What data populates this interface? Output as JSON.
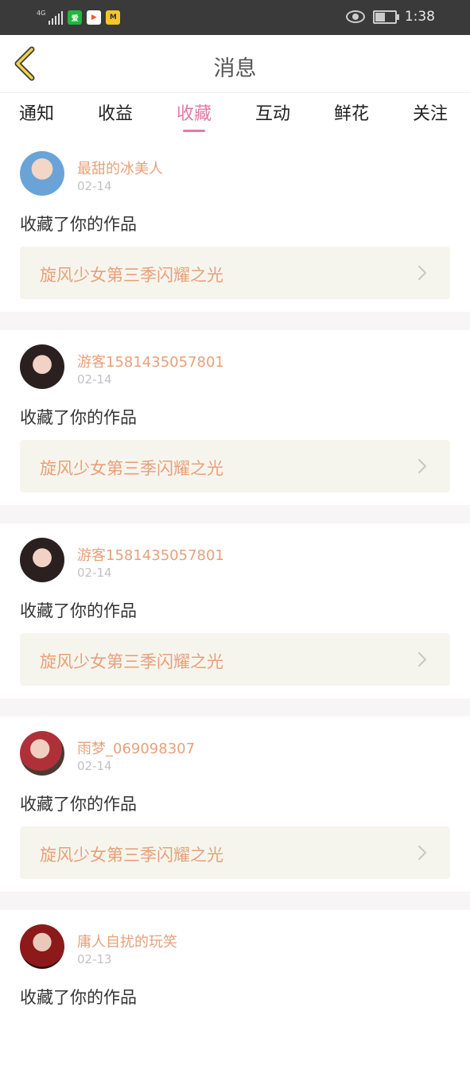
{
  "status_bar": {
    "network": "4G",
    "apps": [
      "爱奇艺",
      "哔哩",
      "M"
    ],
    "time": "1:38",
    "battery_level": 0.55
  },
  "header": {
    "title": "消息"
  },
  "tabs": [
    {
      "label": "通知",
      "active": false
    },
    {
      "label": "收益",
      "active": false
    },
    {
      "label": "收藏",
      "active": true
    },
    {
      "label": "互动",
      "active": false
    },
    {
      "label": "鲜花",
      "active": false
    },
    {
      "label": "关注",
      "active": false
    }
  ],
  "accent_color": "#e27aa6",
  "username_color": "#e8a07a",
  "messages": [
    {
      "user": "最甜的冰美人",
      "date": "02-14",
      "action": "收藏了你的作品",
      "work": "旋风少女第三季闪耀之光"
    },
    {
      "user": "游客1581435057801",
      "date": "02-14",
      "action": "收藏了你的作品",
      "work": "旋风少女第三季闪耀之光"
    },
    {
      "user": "游客1581435057801",
      "date": "02-14",
      "action": "收藏了你的作品",
      "work": "旋风少女第三季闪耀之光"
    },
    {
      "user": "雨梦_069098307",
      "date": "02-14",
      "action": "收藏了你的作品",
      "work": "旋风少女第三季闪耀之光"
    },
    {
      "user": "庸人自扰的玩笑",
      "date": "02-13",
      "action": "收藏了你的作品",
      "work": ""
    }
  ]
}
